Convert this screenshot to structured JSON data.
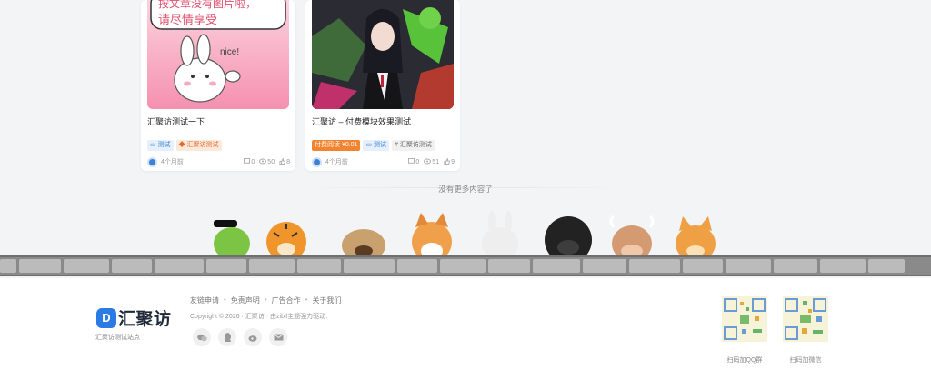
{
  "posts": [
    {
      "title": "汇聚访测试一下",
      "thumb_text_line1": "按文章没有图片啦，",
      "thumb_text_line2": "请尽情享受",
      "thumb_speech": "nice!",
      "tags": [
        "测试",
        "汇聚访测试"
      ],
      "time": "4个月前",
      "comments": "0",
      "views": "50",
      "likes": "8"
    },
    {
      "title": "汇聚访 – 付费模块效果测试",
      "pay_badge": "付费阅读",
      "price": "¥0.01",
      "tags": [
        "测试",
        "汇聚访测试"
      ],
      "time": "4个月前",
      "comments": "0",
      "views": "51",
      "likes": "9"
    }
  ],
  "no_more": "没有更多内容了",
  "footer": {
    "logo_text": "汇聚访",
    "site_desc": "汇聚访测试站点",
    "links": [
      "友链申请",
      "免责声明",
      "广告合作",
      "关于我们"
    ],
    "copyright": "Copyright © 2026 · 汇聚访 · 由zibll主题强力驱动.",
    "socials": [
      "wechat-icon",
      "qq-icon",
      "weibo-icon",
      "mail-icon"
    ],
    "qr": [
      {
        "label": "扫码加QQ群"
      },
      {
        "label": "扫码加微信"
      }
    ]
  }
}
